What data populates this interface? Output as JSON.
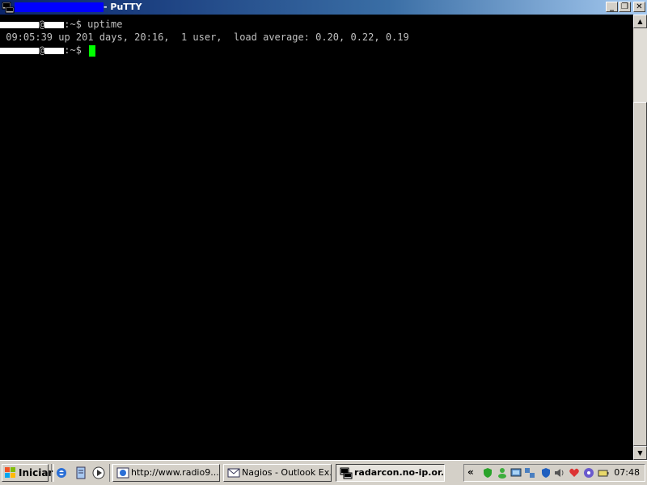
{
  "window": {
    "title_suffix": "- PuTTY",
    "buttons": {
      "minimize": "_",
      "maximize": "❐",
      "close": "✕"
    }
  },
  "terminal": {
    "line1": {
      "prompt_suffix": ":~$",
      "command": "uptime"
    },
    "line2": {
      "output": " 09:05:39 up 201 days, 20:16,  1 user,  load average: 0.20, 0.22, 0.19"
    },
    "line3": {
      "prompt_suffix": ":~$"
    },
    "cursor_color": "#00ff00"
  },
  "taskbar": {
    "start_label": "Iniciar",
    "quick_launch_icons": [
      "internet-explorer-icon",
      "notepad-icon",
      "media-player-icon"
    ],
    "tasks": [
      {
        "label": "http://www.radio9...",
        "icon": "browser-icon"
      },
      {
        "label": "Nagios - Outlook Ex...",
        "icon": "outlook-icon"
      },
      {
        "label": "radarcon.no-ip.or...",
        "icon": "putty-icon",
        "active": true
      }
    ],
    "tray": {
      "chevron": "«",
      "icons": [
        "security-icon",
        "messenger-icon",
        "network-icon",
        "display-icon",
        "antivirus-icon",
        "volume-icon",
        "mail-icon",
        "network-status-icon",
        "battery-icon"
      ],
      "clock": "07:48"
    }
  }
}
